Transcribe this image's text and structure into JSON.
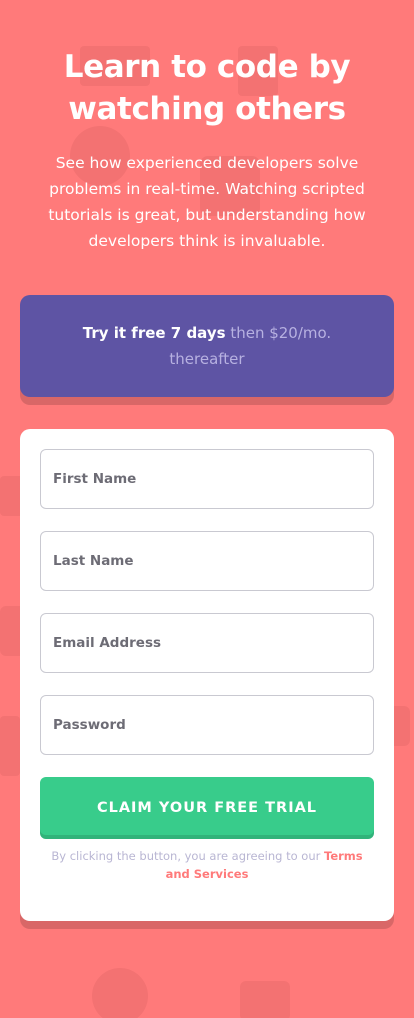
{
  "hero": {
    "title": "Learn to code by watching others",
    "description": "See how experienced developers solve problems in real-time. Watching scripted tutorials is great, but understanding how developers think is invaluable."
  },
  "promo": {
    "highlight": "Try it free 7 days",
    "rest": " then $20/mo. thereafter"
  },
  "form": {
    "fields": [
      {
        "placeholder": "First Name"
      },
      {
        "placeholder": "Last Name"
      },
      {
        "placeholder": "Email Address"
      },
      {
        "placeholder": "Password"
      }
    ],
    "submit_label": "CLAIM YOUR FREE TRIAL",
    "terms_prefix": "By clicking the button, you are agreeing to our ",
    "terms_link": "Terms and Services"
  },
  "colors": {
    "background": "#FF7A7A",
    "promo_bg": "#5E54A4",
    "submit_bg": "#38CC8B",
    "link": "#FF7A7A"
  }
}
